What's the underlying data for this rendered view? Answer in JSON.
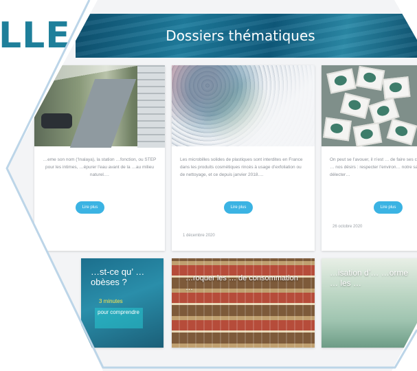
{
  "logo": {
    "partial_text": "LLE"
  },
  "banner": {
    "title": "Dossiers thématiques"
  },
  "cards": [
    {
      "text": "…eme son nom (‘Inalaya), la station …fonction, ou STEP pour les intimes, …épurer l’eau avant de la …au milieu naturel.…",
      "button": "Lire plus",
      "date": ""
    },
    {
      "text": "Les microbilles solides de plastiques sont interdites en France dans les produits cosmétiques rincés à usage d’exfoliation ou de nettoyage, et ce depuis janvier 2018.…",
      "button": "Lire plus",
      "date": "1 décembre 2020"
    },
    {
      "text": "On peut se l’avouer, il n’est … de faire ses courses tout en … nos désirs : respecter l’environ… notre santé, et se délecter…",
      "button": "Lire plus",
      "date": "26 octobre 2020"
    },
    {
      "overlay_text": "…st-ce qu’ … obèses ?",
      "overlay_sub": "3 minutes",
      "overlay_box": "pour comprendre"
    },
    {
      "overlay_text": "…roquer les … de consommation …"
    },
    {
      "overlay_text": "…isation d’… …orme … les …"
    }
  ]
}
